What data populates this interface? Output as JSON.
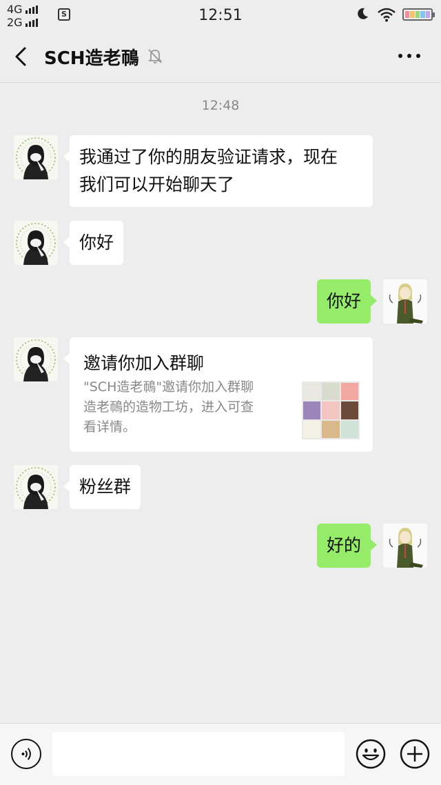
{
  "status_bar": {
    "signal_1": "4G",
    "signal_2": "2G",
    "badge": "S",
    "time": "12:51",
    "battery_colors": [
      "#f58b9a",
      "#f7c26b",
      "#9ad97a",
      "#7fc7f0",
      "#c3a5ea"
    ]
  },
  "header": {
    "back_icon": "chevron-left-icon",
    "title": "SCH造老鳾",
    "mute_icon": "bell-off-icon",
    "more_icon": "more-dots-icon"
  },
  "chat": {
    "timestamp": "12:48",
    "messages": [
      {
        "side": "left",
        "text_line1": "我通过了你的朋友验证请求，现在",
        "text_line2": "我们可以开始聊天了"
      },
      {
        "side": "left",
        "text": "你好"
      },
      {
        "side": "right",
        "text": "你好"
      },
      {
        "side": "left",
        "type": "invite_card",
        "title": "邀请你加入群聊",
        "desc_line1": "\"SCH造老鳾\"邀请你加入群聊",
        "desc_line2": "造老鳾的造物工坊，进入可查",
        "desc_line3": "看详情。"
      },
      {
        "side": "left",
        "text": "粉丝群"
      },
      {
        "side": "right",
        "text": "好的"
      }
    ]
  },
  "input_bar": {
    "voice_icon": "voice-icon",
    "input_value": "",
    "emoji_icon": "emoji-icon",
    "plus_icon": "plus-icon"
  }
}
